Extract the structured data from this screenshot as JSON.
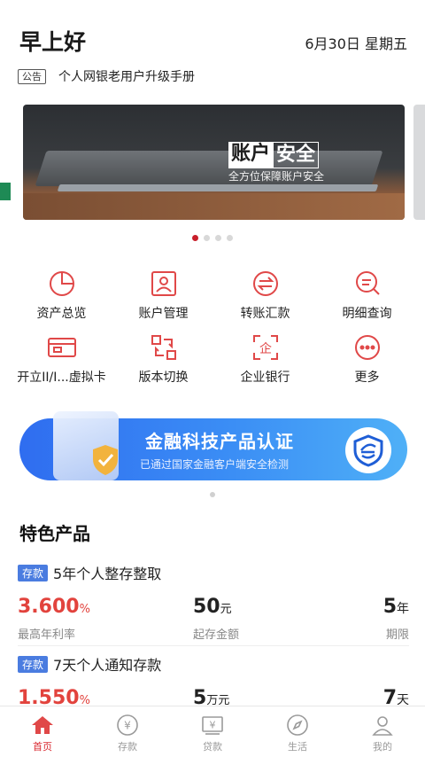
{
  "header": {
    "greeting": "早上好",
    "date": "6月30日 星期五",
    "notice_tag": "公告",
    "notice_text": "个人网银老用户升级手册"
  },
  "banner": {
    "title_part1": "账户",
    "title_part2": "安全",
    "subtitle": "全方位保障账户安全",
    "page_count": 4,
    "active_page": 0
  },
  "quick_menu": [
    {
      "label": "资产总览",
      "icon": "pie-chart-icon"
    },
    {
      "label": "账户管理",
      "icon": "account-card-icon"
    },
    {
      "label": "转账汇款",
      "icon": "transfer-icon"
    },
    {
      "label": "明细查询",
      "icon": "detail-search-icon"
    },
    {
      "label": "开立II/I...虚拟卡",
      "icon": "virtual-card-icon"
    },
    {
      "label": "版本切换",
      "icon": "switch-icon"
    },
    {
      "label": "企业银行",
      "icon": "enterprise-icon"
    },
    {
      "label": "更多",
      "icon": "more-icon"
    }
  ],
  "promo": {
    "title": "金融科技产品认证",
    "subtitle": "已通过国家金融客户端安全检测"
  },
  "featured": {
    "section_title": "特色产品",
    "products": [
      {
        "tag": "存款",
        "name": "5年个人整存整取",
        "rate": "3.600",
        "rate_unit": "%",
        "rate_label": "最高年利率",
        "min_amount": "50",
        "min_amount_unit": "元",
        "min_amount_label": "起存金额",
        "term": "5",
        "term_unit": "年",
        "term_label": "期限"
      },
      {
        "tag": "存款",
        "name": "7天个人通知存款",
        "rate": "1.550",
        "rate_unit": "%",
        "min_amount": "5",
        "min_amount_unit": "万元",
        "term": "7",
        "term_unit": "天"
      }
    ]
  },
  "tabbar": [
    {
      "label": "首页",
      "icon": "home-icon",
      "active": true
    },
    {
      "label": "存款",
      "icon": "deposit-icon",
      "active": false
    },
    {
      "label": "贷款",
      "icon": "loan-icon",
      "active": false
    },
    {
      "label": "生活",
      "icon": "compass-icon",
      "active": false
    },
    {
      "label": "我的",
      "icon": "profile-icon",
      "active": false
    }
  ],
  "colors": {
    "brand_red": "#d9282f",
    "rate_red": "#e2433d",
    "tag_blue": "#4a7ce0",
    "promo_blue": "#2f6df0"
  }
}
